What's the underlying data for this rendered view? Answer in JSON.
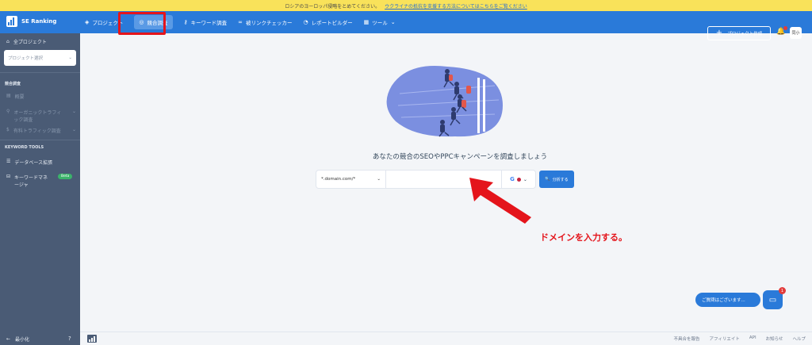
{
  "banner": {
    "text": "ロシアのヨーロッパ侵略をとめてください。",
    "link": "ウクライナの抵抗を支援する方法についてはこちらをご覧ください"
  },
  "topnav": {
    "brand": "SE Ranking",
    "items": [
      {
        "label": "プロジェクト",
        "icon": "layers-icon"
      },
      {
        "label": "競合調査",
        "icon": "target-icon"
      },
      {
        "label": "キーワード調査",
        "icon": "key-icon"
      },
      {
        "label": "被リンクチェッカー",
        "icon": "link-icon"
      },
      {
        "label": "レポートビルダー",
        "icon": "report-icon"
      },
      {
        "label": "ツール",
        "icon": "grid-icon"
      }
    ],
    "create_project": "プロジェクト作成",
    "avatar": "同小"
  },
  "sidebar": {
    "all_projects": "全プロジェクト",
    "project_select_placeholder": "プロジェクト選択",
    "section_competitor": "競合調査",
    "overview": "概要",
    "organic": "オーガニックトラフィック調査",
    "paid": "有料トラフィック調査",
    "section_keyword": "KEYWORD TOOLS",
    "db_expand": "データベース拡張",
    "kw_manager": "キーワードマネージャ",
    "beta": "Beta",
    "minimize": "最小化"
  },
  "main": {
    "headline": "あなたの競合のSEOやPPCキャンペーンを調査しましょう",
    "domain_mode": "*.domain.com/*",
    "domain_input_value": "",
    "engine_label": "G",
    "analyze": "分析する"
  },
  "annotation": {
    "text": "ドメインを入力する。",
    "color": "#e4141b"
  },
  "chat": {
    "prompt": "ご質問はございます...",
    "badge": "1"
  },
  "footer": {
    "links": [
      "不具合を報告",
      "アフィリエイト",
      "API",
      "お知らせ",
      "ヘルプ"
    ]
  }
}
